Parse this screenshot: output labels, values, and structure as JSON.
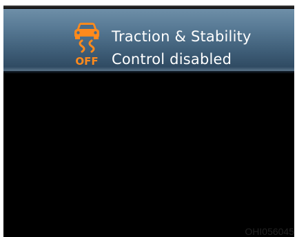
{
  "warning": {
    "icon": "traction-control-off-icon",
    "icon_label": "OFF",
    "line1": "Traction & Stability",
    "line2": "Control disabled"
  },
  "watermark": "OHI056045",
  "colors": {
    "banner": "#4a6a86",
    "icon": "#ff8a1c",
    "text": "#ffffff",
    "background": "#000000"
  }
}
